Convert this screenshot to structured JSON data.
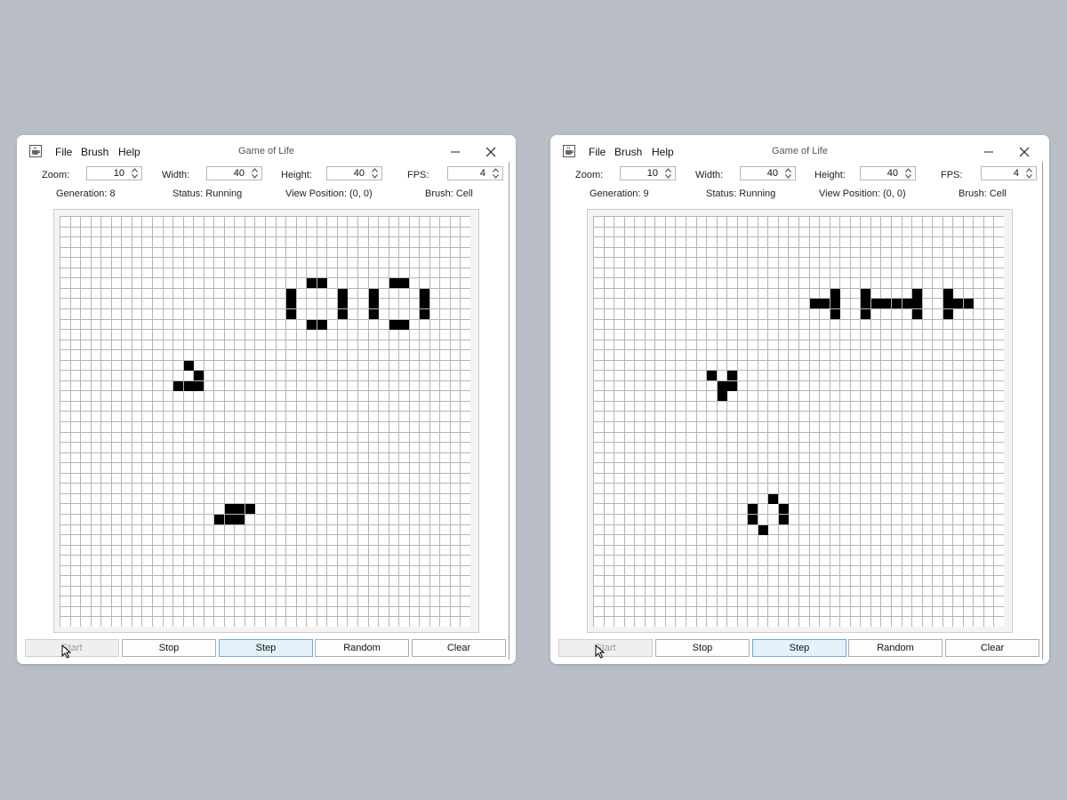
{
  "menu": {
    "file": "File",
    "brush": "Brush",
    "help": "Help"
  },
  "labels": {
    "zoom": "Zoom:",
    "width": "Width:",
    "height": "Height:",
    "fps": "FPS:"
  },
  "buttons": {
    "start": "Start",
    "stop": "Stop",
    "step": "Step",
    "random": "Random",
    "clear": "Clear"
  },
  "icons": {
    "app": "java-cup-icon",
    "minimize": "minimize-icon",
    "close": "close-icon",
    "spin_up": "chevron-up-icon",
    "spin_down": "chevron-down-icon",
    "cursor": "mouse-cursor-icon"
  },
  "colors": {
    "background": "#b9bdc5",
    "live_cell": "#000000",
    "grid_line": "#b5b5b5",
    "step_highlight": "#e5f1fb"
  },
  "windows": [
    {
      "title": "Game of Life",
      "controls": {
        "zoom": "10",
        "width": "40",
        "height": "40",
        "fps": "4"
      },
      "status": {
        "generation": "Generation: 8",
        "state": "Status: Running",
        "view_position": "View Position: (0, 0)",
        "brush": "Brush: Cell"
      },
      "grid": {
        "cols": 40,
        "rows": 40,
        "live_cells": [
          [
            24,
            6
          ],
          [
            25,
            6
          ],
          [
            32,
            6
          ],
          [
            33,
            6
          ],
          [
            22,
            7
          ],
          [
            27,
            7
          ],
          [
            30,
            7
          ],
          [
            35,
            7
          ],
          [
            22,
            8
          ],
          [
            27,
            8
          ],
          [
            30,
            8
          ],
          [
            35,
            8
          ],
          [
            22,
            9
          ],
          [
            27,
            9
          ],
          [
            30,
            9
          ],
          [
            35,
            9
          ],
          [
            24,
            10
          ],
          [
            25,
            10
          ],
          [
            32,
            10
          ],
          [
            33,
            10
          ],
          [
            12,
            14
          ],
          [
            13,
            15
          ],
          [
            11,
            16
          ],
          [
            12,
            16
          ],
          [
            13,
            16
          ],
          [
            16,
            28
          ],
          [
            17,
            28
          ],
          [
            18,
            28
          ],
          [
            15,
            29
          ],
          [
            16,
            29
          ],
          [
            17,
            29
          ]
        ]
      }
    },
    {
      "title": "Game of Life",
      "controls": {
        "zoom": "10",
        "width": "40",
        "height": "40",
        "fps": "4"
      },
      "status": {
        "generation": "Generation: 9",
        "state": "Status: Running",
        "view_position": "View Position: (0, 0)",
        "brush": "Brush: Cell"
      },
      "grid": {
        "cols": 40,
        "rows": 40,
        "live_cells": [
          [
            23,
            7
          ],
          [
            26,
            7
          ],
          [
            31,
            7
          ],
          [
            34,
            7
          ],
          [
            21,
            8
          ],
          [
            22,
            8
          ],
          [
            23,
            8
          ],
          [
            26,
            8
          ],
          [
            27,
            8
          ],
          [
            28,
            8
          ],
          [
            29,
            8
          ],
          [
            30,
            8
          ],
          [
            31,
            8
          ],
          [
            34,
            8
          ],
          [
            35,
            8
          ],
          [
            36,
            8
          ],
          [
            23,
            9
          ],
          [
            26,
            9
          ],
          [
            31,
            9
          ],
          [
            34,
            9
          ],
          [
            11,
            15
          ],
          [
            13,
            15
          ],
          [
            12,
            16
          ],
          [
            13,
            16
          ],
          [
            12,
            17
          ],
          [
            17,
            27
          ],
          [
            15,
            28
          ],
          [
            18,
            28
          ],
          [
            15,
            29
          ],
          [
            18,
            29
          ],
          [
            16,
            30
          ]
        ]
      }
    }
  ]
}
